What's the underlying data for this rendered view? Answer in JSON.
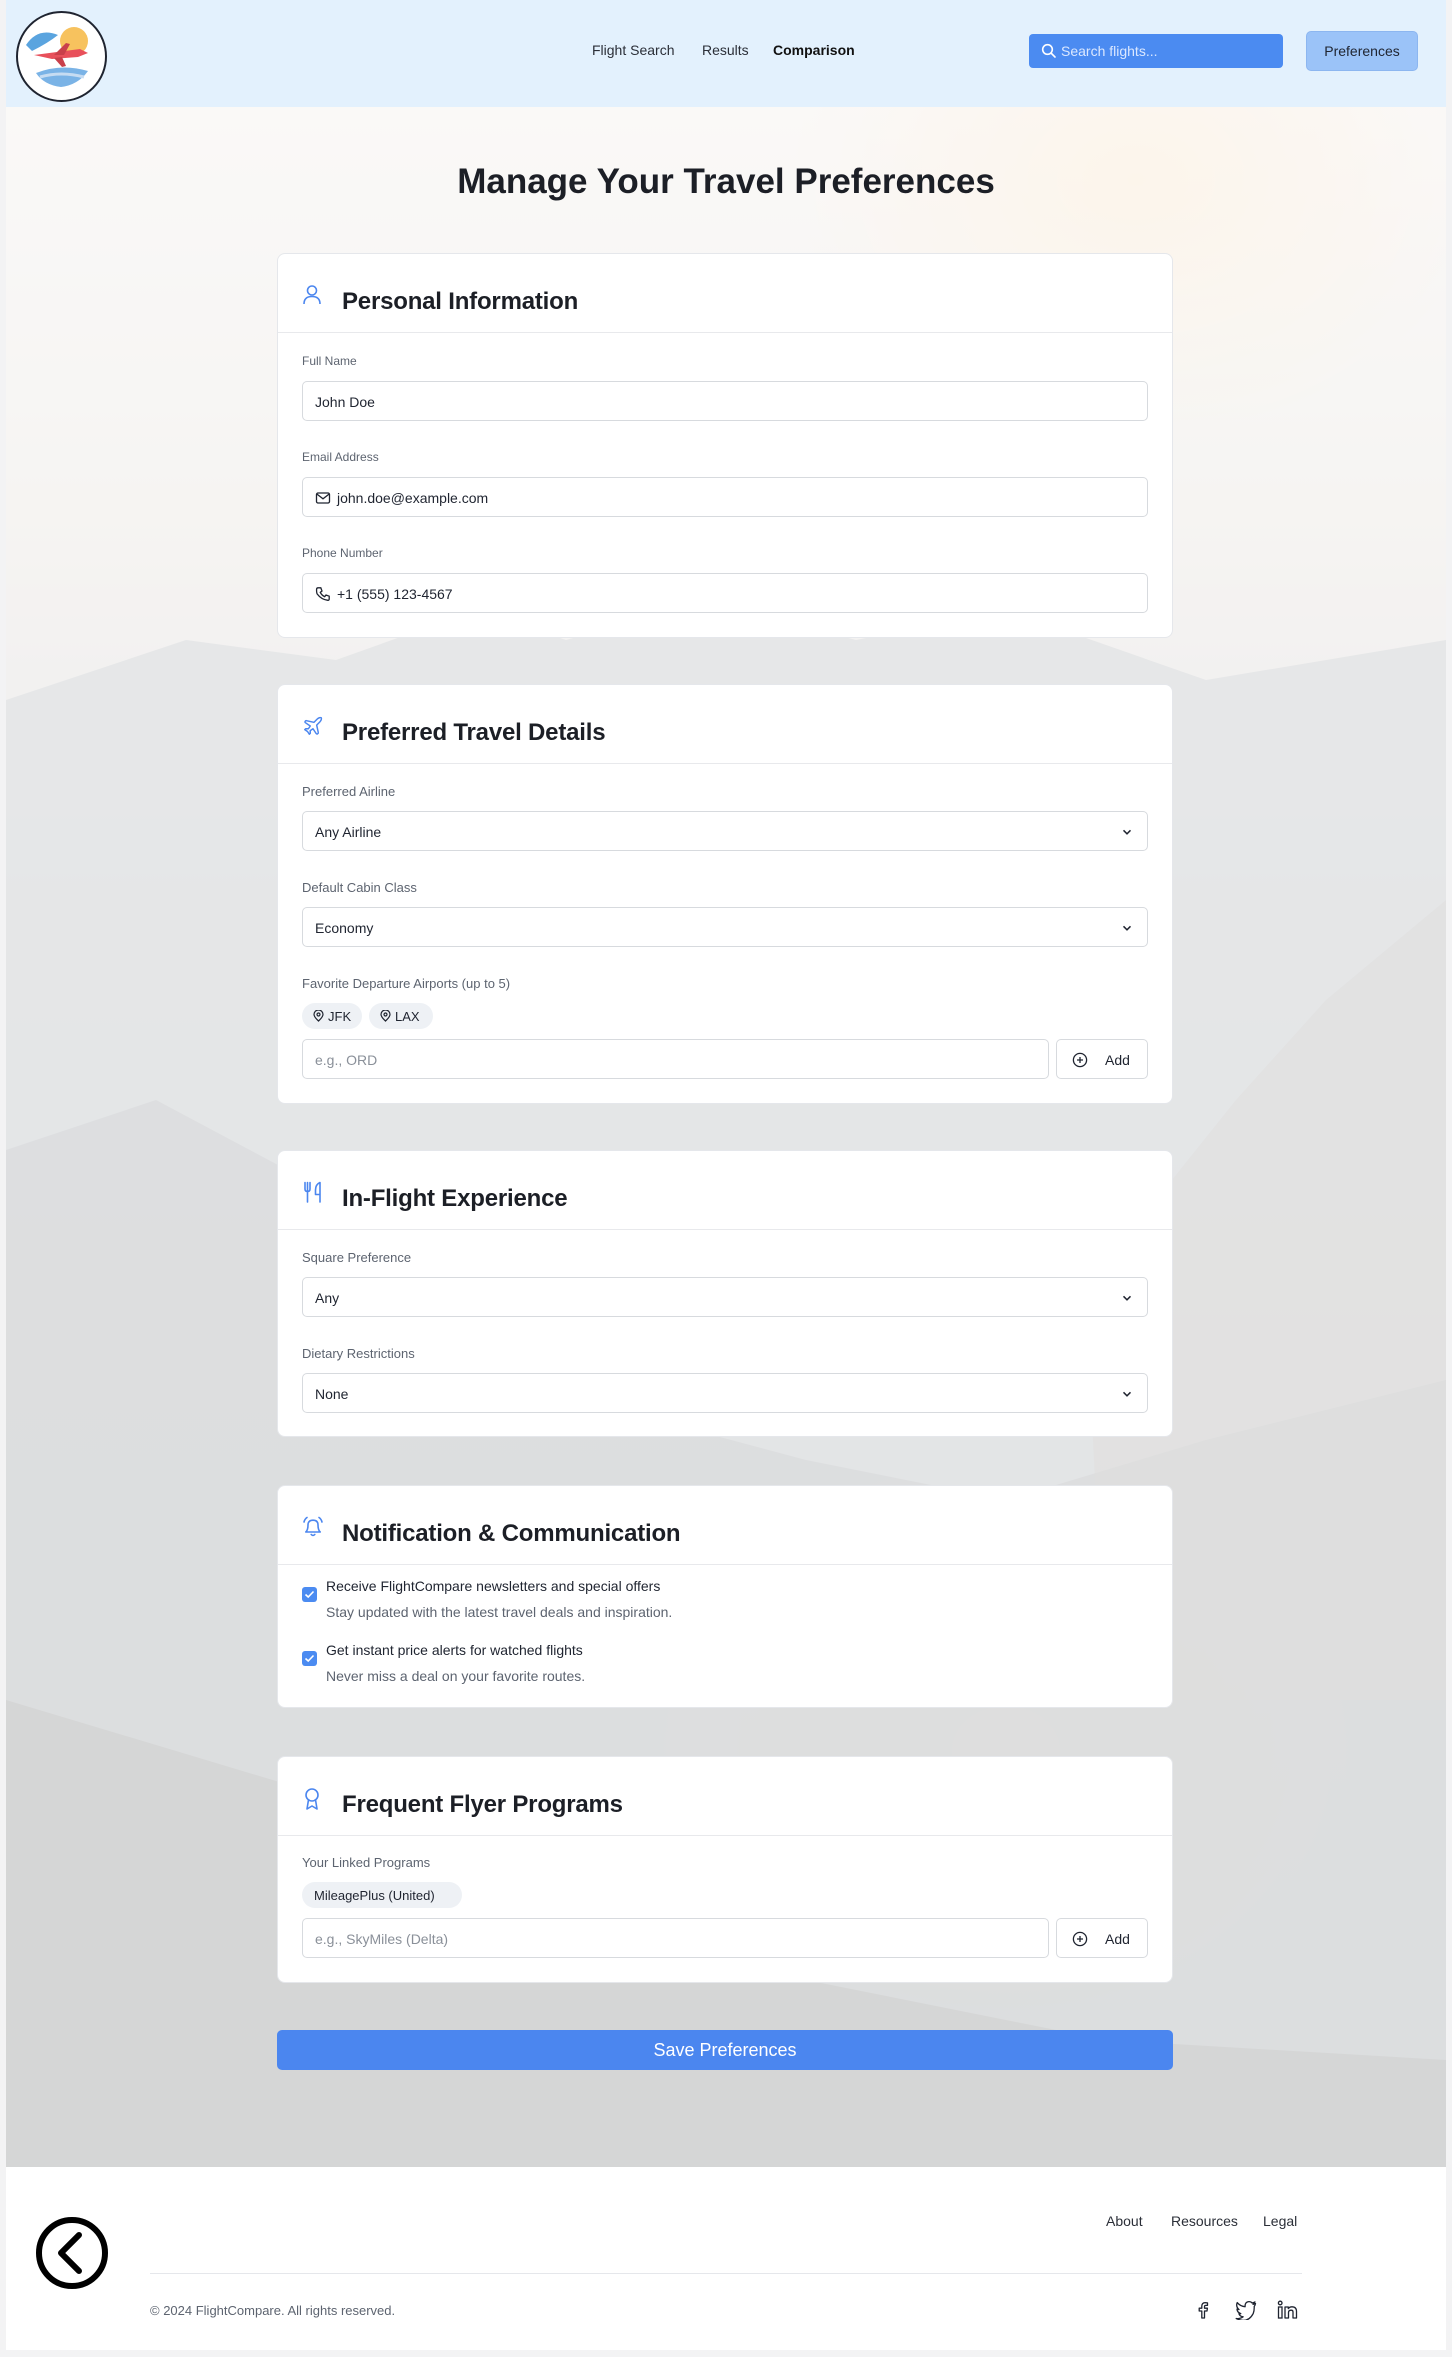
{
  "header": {
    "nav": [
      "Flight Search",
      "Results",
      "Comparison"
    ],
    "active_nav": "Comparison",
    "search_placeholder": "Search flights...",
    "preferences_label": "Preferences"
  },
  "page": {
    "title": "Manage Your Travel Preferences"
  },
  "personal": {
    "title": "Personal Information",
    "name_label": "Full Name",
    "name_value": "John Doe",
    "email_label": "Email Address",
    "email_value": "john.doe@example.com",
    "phone_label": "Phone Number",
    "phone_value": "+1 (555) 123-4567"
  },
  "travel": {
    "title": "Preferred Travel Details",
    "airline_label": "Preferred Airline",
    "airline_value": "Any Airline",
    "cabin_label": "Default Cabin Class",
    "cabin_value": "Economy",
    "airports_label": "Favorite Departure Airports (up to 5)",
    "airports": [
      "JFK",
      "LAX"
    ],
    "airport_placeholder": "e.g., ORD",
    "add_label": "Add"
  },
  "inflight": {
    "title": "In-Flight Experience",
    "square_label": "Square Preference",
    "square_value": "Any",
    "dietary_label": "Dietary Restrictions",
    "dietary_value": "None"
  },
  "notifications": {
    "title": "Notification & Communication",
    "options": [
      {
        "title": "Receive FlightCompare newsletters and special offers",
        "subtitle": "Stay updated with the latest travel deals and inspiration.",
        "checked": true
      },
      {
        "title": "Get instant price alerts for watched flights",
        "subtitle": "Never miss a deal on your favorite routes.",
        "checked": true
      }
    ]
  },
  "frequent": {
    "title": "Frequent Flyer Programs",
    "linked_label": "Your Linked Programs",
    "programs": [
      "MileagePlus (United)"
    ],
    "placeholder": "e.g., SkyMiles (Delta)",
    "add_label": "Add"
  },
  "save_label": "Save Preferences",
  "footer": {
    "links": [
      "About",
      "Resources",
      "Legal"
    ],
    "copyright": "© 2024 FlightCompare. All rights reserved.",
    "social": [
      "facebook-icon",
      "twitter-icon",
      "linkedin-icon"
    ]
  },
  "colors": {
    "accent": "#4b86ef",
    "header_bg": "#e3f1fd",
    "preferences_button": "#9bc3f8"
  }
}
